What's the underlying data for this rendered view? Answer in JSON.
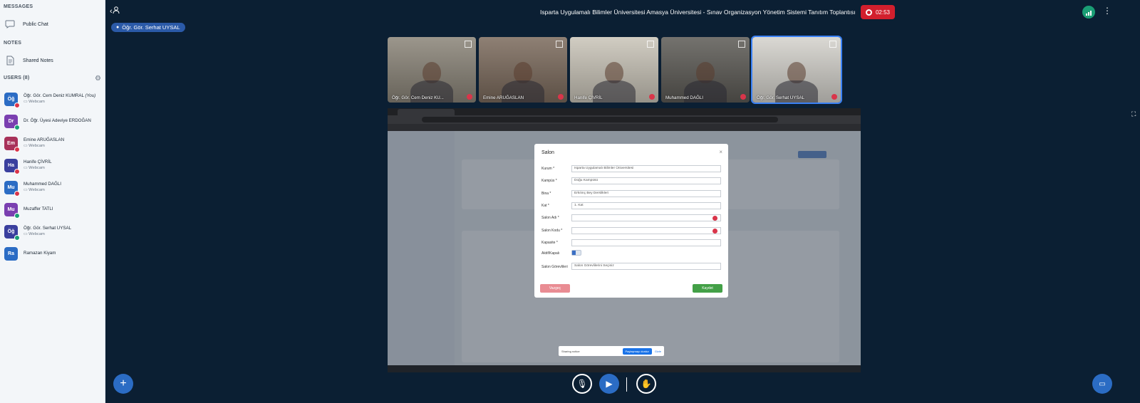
{
  "sidebar": {
    "messages_title": "MESSAGES",
    "public_chat": "Public Chat",
    "notes_title": "NOTES",
    "shared_notes": "Shared Notes",
    "users_title": "USERS (8)",
    "users": [
      {
        "initials": "Öğ",
        "name": "Öğr. Gör. Cem Deniz KUMRAL",
        "you": "(You)",
        "sub": "Webcam",
        "color": "#2b6cc4",
        "mic": "muted"
      },
      {
        "initials": "Dr",
        "name": "Dr. Öğr. Üyesi Adeviye ERDOĞAN",
        "you": "",
        "sub": "",
        "color": "#7a3fb0",
        "mic": "on"
      },
      {
        "initials": "Em",
        "name": "Emine ARUĞASLAN",
        "you": "",
        "sub": "Webcam",
        "color": "#a8325a",
        "mic": "muted"
      },
      {
        "initials": "Ha",
        "name": "Hanife ÇİVRİL",
        "you": "",
        "sub": "Webcam",
        "color": "#3a3f9e",
        "mic": "muted"
      },
      {
        "initials": "Mu",
        "name": "Muhammed DAĞLI",
        "you": "",
        "sub": "Webcam",
        "color": "#2b6cc4",
        "mic": "muted"
      },
      {
        "initials": "Mu",
        "name": "Muzaffer TATLI",
        "you": "",
        "sub": "",
        "color": "#7a3fb0",
        "mic": "on"
      },
      {
        "initials": "Öğ",
        "name": "Öğr. Gör. Serhat UYSAL",
        "you": "",
        "sub": "Webcam",
        "color": "#3a3f9e",
        "mic": "on"
      },
      {
        "initials": "Ra",
        "name": "Ramazan Kiyam",
        "you": "",
        "sub": "",
        "color": "#2b6cc4",
        "mic": "none"
      }
    ]
  },
  "header": {
    "meeting_title": "Isparta Uygulamalı Bilimler Üniversitesi Amasya Üniversitesi - Sınav Organizasyon Yönetim Sistemi Tanıtım Toplantısı",
    "recording_time": "02:53",
    "presenter": "Öğr. Gör. Serhat UYSAL"
  },
  "webcams": [
    {
      "name": "Öğr. Gör. Cem Deniz KU...",
      "bg": "#8a8478"
    },
    {
      "name": "Emine ARUĞASLAN",
      "bg": "#7b6a5c"
    },
    {
      "name": "Hanife ÇİVRİL",
      "bg": "#c9c4b8"
    },
    {
      "name": "Muhammed DAĞLI",
      "bg": "#5c5a55"
    },
    {
      "name": "Öğr. Gör. Serhat UYSAL",
      "bg": "#d4d2cc"
    }
  ],
  "screenshare": {
    "modal_title": "Salon",
    "fields": [
      {
        "label": "Kurum *",
        "value": "Isparta Uygulamalı Bilimler Üniversitesi",
        "error": false
      },
      {
        "label": "Kampüs *",
        "value": "Doğu Kampüsü",
        "error": false
      },
      {
        "label": "Bina *",
        "value": "Erkılınç Bey Derslikleri",
        "error": false
      },
      {
        "label": "Kat *",
        "value": "1. Kat",
        "error": false
      },
      {
        "label": "Salon Adı *",
        "value": "",
        "error": true
      },
      {
        "label": "Salon Kodu *",
        "value": "",
        "error": true
      },
      {
        "label": "Kapasite *",
        "value": "",
        "error": false
      }
    ],
    "active_label": "Aktif/Kapalı",
    "staff_label": "Salon Görevlileri",
    "staff_placeholder": "Salon Görevlilerini Seçiniz",
    "cancel_label": "Vazgeç",
    "save_label": "Kaydet",
    "share_notice": "Sharing notice",
    "stop_share_label": "Paylaşmayı durdur",
    "hide_label": "Gizle"
  },
  "colors": {
    "background": "#0b1f33",
    "sidebar": "#f3f6f9",
    "accent": "#2b5aa8",
    "record": "#d21f2d"
  }
}
